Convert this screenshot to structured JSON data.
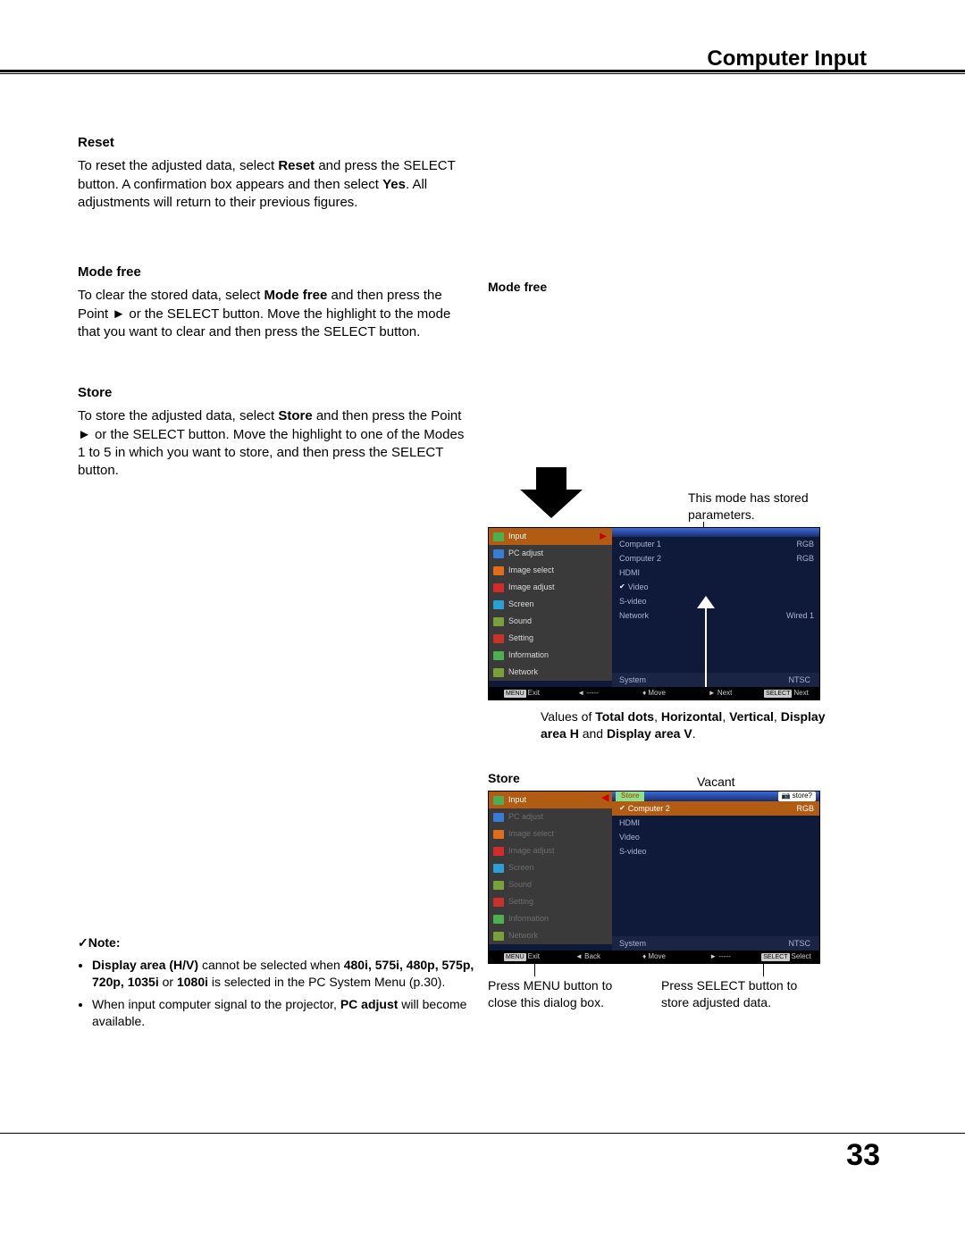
{
  "header": {
    "title": "Computer Input"
  },
  "page_number": "33",
  "sections": {
    "reset": {
      "heading": "Reset",
      "text_parts": [
        "To reset the adjusted data, select ",
        "Reset",
        " and press the SELECT button. A confirmation box appears and then select ",
        "Yes",
        ". All adjustments will return to their previous figures."
      ]
    },
    "mode_free": {
      "heading": "Mode free",
      "text_parts": [
        "To clear the stored data, select ",
        "Mode free",
        " and then press the Point ► or the SELECT button. Move the highlight to the mode that you want to clear and then press the SELECT button."
      ]
    },
    "store": {
      "heading": "Store",
      "text_parts": [
        "To store the adjusted data, select ",
        "Store",
        " and then press the Point ► or the SELECT button. Move the highlight to one of the Modes 1 to 5 in which you want to store, and then press the SELECT button."
      ]
    }
  },
  "right": {
    "mode_free_label": "Mode free",
    "stored_ann": "This mode has stored parameters.",
    "values_ann_parts": [
      "Values of ",
      "Total dots",
      ", ",
      "Horizontal",
      ", ",
      "Vertical",
      ", ",
      "Display area H",
      " and ",
      "Display area V",
      "."
    ],
    "store_label": "Store",
    "vacant_label": "Vacant",
    "press_menu": "Press MENU button to close this dialog box.",
    "press_select": "Press SELECT button to store adjusted data."
  },
  "note": {
    "title": "Note:",
    "items": [
      {
        "parts": [
          "Display area (H/V)",
          " cannot be selected when ",
          "480i, 575i, 480p, 575p, 720p, 1035i",
          " or ",
          "1080i",
          " is selected in the PC System Menu (p.30)."
        ]
      },
      {
        "parts": [
          "When input computer signal to the projector, ",
          "PC adjust",
          " will become available."
        ]
      }
    ]
  },
  "menu_common": {
    "left_items": [
      "Input",
      "PC adjust",
      "Image select",
      "Image adjust",
      "Screen",
      "Sound",
      "Setting",
      "Information",
      "Network"
    ],
    "footer": {
      "exit": "Exit",
      "back": "Back",
      "dashes": "-----",
      "move": "Move",
      "next": "Next",
      "select": "Select",
      "menu": "MENU",
      "sel": "SELECT"
    }
  },
  "menu1": {
    "sub_items": [
      "Computer 1",
      "Computer 2",
      "HDMI",
      "Video",
      "S-video",
      "Network"
    ],
    "checked_index": 3,
    "right_vals": [
      "RGB",
      "RGB",
      "",
      "",
      "",
      "Wired 1"
    ],
    "system_label": "System",
    "system_value": "NTSC"
  },
  "menu2": {
    "top_left": "Store",
    "top_right": "store?",
    "sub_items": [
      "Computer 2",
      "HDMI",
      "Video",
      "S-video"
    ],
    "selected_index": 0,
    "right_val": "RGB",
    "system_label": "System",
    "system_value": "NTSC"
  },
  "icons": {
    "colors": [
      "#4caf50",
      "#3a7bd5",
      "#e06c1c",
      "#d42a2a",
      "#2aa0d4",
      "#7aa03a",
      "#c9322a",
      "#4caf50",
      "#7aa03a"
    ]
  }
}
